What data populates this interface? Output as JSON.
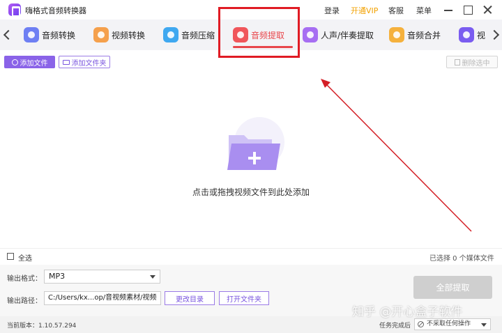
{
  "app": {
    "title": "嗨格式音频转换器",
    "login": "登录",
    "vip": "开通VIP",
    "service": "客服",
    "menu": "菜单"
  },
  "tabs": [
    {
      "label": "音频转换",
      "icon": "headphones-icon",
      "color": "#6e7ff3"
    },
    {
      "label": "视频转换",
      "icon": "video-play-icon",
      "color": "#f5a04c"
    },
    {
      "label": "音频压缩",
      "icon": "audio-compress-icon",
      "color": "#3fa8f0"
    },
    {
      "label": "音频提取",
      "icon": "microphone-icon",
      "color": "#f0565b",
      "active": true
    },
    {
      "label": "人声/伴奏提取",
      "icon": "vocal-separate-icon",
      "color": "#a66ef2"
    },
    {
      "label": "音频合并",
      "icon": "audio-merge-icon",
      "color": "#f5b13d"
    },
    {
      "label": "视",
      "icon": "video-icon",
      "color": "#7a5cf0"
    }
  ],
  "toolbar": {
    "add_file": "添加文件",
    "add_folder": "添加文件夹",
    "delete_selected": "删除选中"
  },
  "dropzone": {
    "hint": "点击或拖拽视频文件到此处添加"
  },
  "selection": {
    "select_all": "全选",
    "selected_count": "已选择 0 个媒体文件"
  },
  "settings": {
    "format_label": "输出格式：",
    "format_value": "MP3",
    "path_label": "输出路径：",
    "path_value": "C:/Users/kx...op/音视频素材/视频",
    "change_dir": "更改目录",
    "open_folder": "打开文件夹",
    "extract_all": "全部提取"
  },
  "status": {
    "version": "当前版本：1.10.57.294",
    "after_task_label": "任务完成后",
    "after_task_value": "不采取任何操作"
  },
  "watermark": "知乎 @开心盒子软件"
}
